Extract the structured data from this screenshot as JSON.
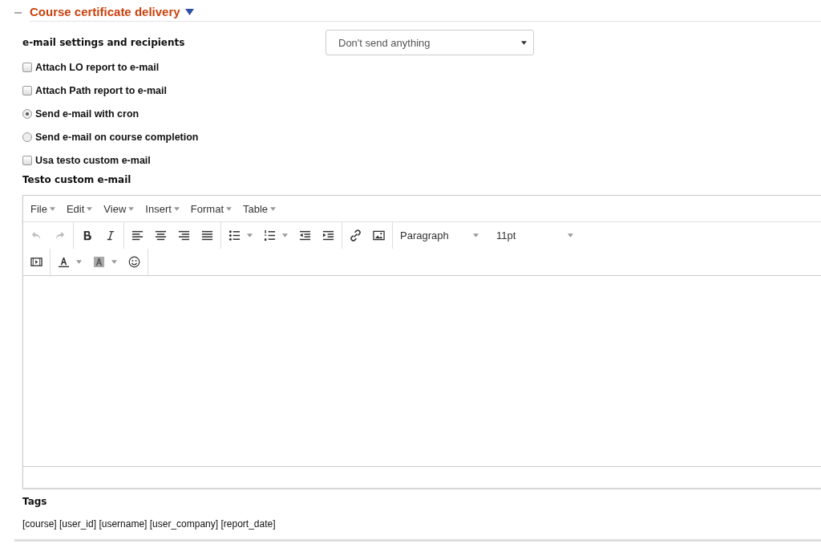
{
  "section": {
    "title": "Course certificate delivery",
    "expanded": true
  },
  "email_settings": {
    "label": "e-mail settings and recipients",
    "select_value": "Don't send anything"
  },
  "options": [
    {
      "kind": "checkbox",
      "label": "Attach LO report to e-mail",
      "checked": false
    },
    {
      "kind": "checkbox",
      "label": "Attach Path report to e-mail",
      "checked": false
    },
    {
      "kind": "radio",
      "label": "Send e-mail with cron",
      "checked": true
    },
    {
      "kind": "radio",
      "label": "Send e-mail on course completion",
      "checked": false
    },
    {
      "kind": "checkbox",
      "label": "Usa testo custom e-mail",
      "checked": false
    }
  ],
  "editor": {
    "label": "Testo custom e-mail",
    "menu": [
      "File",
      "Edit",
      "View",
      "Insert",
      "Format",
      "Table"
    ],
    "block_format": "Paragraph",
    "font_size": "11pt"
  },
  "tags": {
    "label": "Tags",
    "text": "[course] [user_id] [username] [user_company] [report_date]"
  }
}
